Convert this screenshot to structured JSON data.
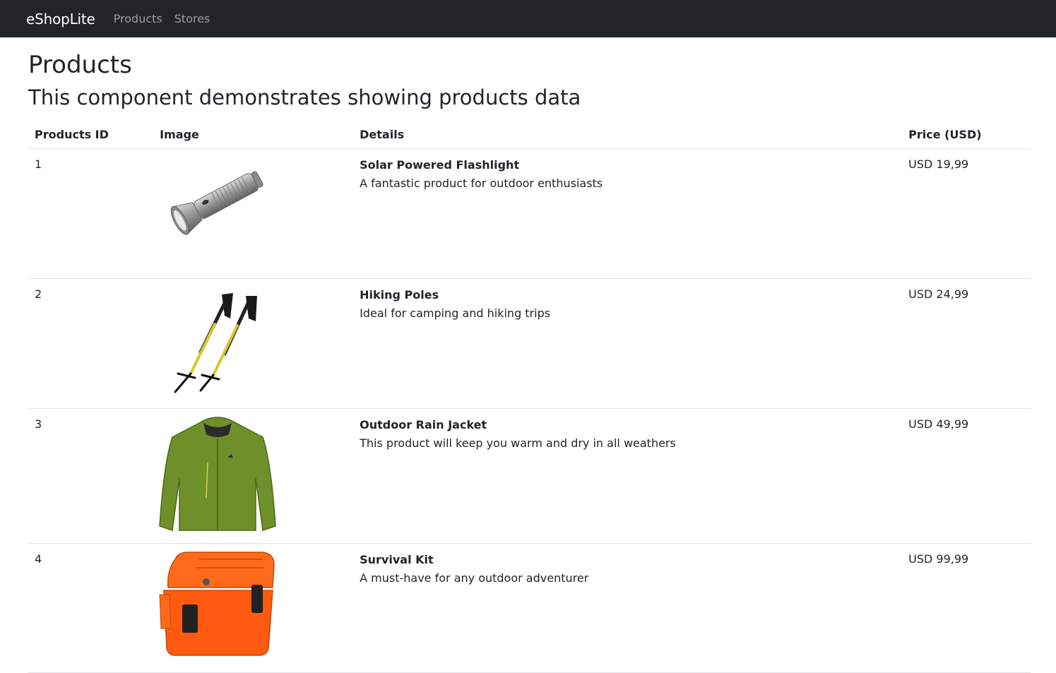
{
  "navbar": {
    "brand": "eShopLite",
    "links": [
      "Products",
      "Stores"
    ]
  },
  "page": {
    "title": "Products",
    "subtitle": "This component demonstrates showing products data"
  },
  "table": {
    "headers": [
      "Products ID",
      "Image",
      "Details",
      "Price (USD)"
    ],
    "rows": [
      {
        "id": "1",
        "name": "Solar Powered Flashlight",
        "description": "A fantastic product for outdoor enthusiasts",
        "price": "USD 19,99",
        "image": "flashlight"
      },
      {
        "id": "2",
        "name": "Hiking Poles",
        "description": "Ideal for camping and hiking trips",
        "price": "USD 24,99",
        "image": "hiking-poles"
      },
      {
        "id": "3",
        "name": "Outdoor Rain Jacket",
        "description": "This product will keep you warm and dry in all weathers",
        "price": "USD 49,99",
        "image": "rain-jacket"
      },
      {
        "id": "4",
        "name": "Survival Kit",
        "description": "A must-have for any outdoor adventurer",
        "price": "USD 99,99",
        "image": "survival-kit"
      }
    ]
  },
  "colors": {
    "navbar_bg": "#212529",
    "border": "#dee2e6"
  }
}
